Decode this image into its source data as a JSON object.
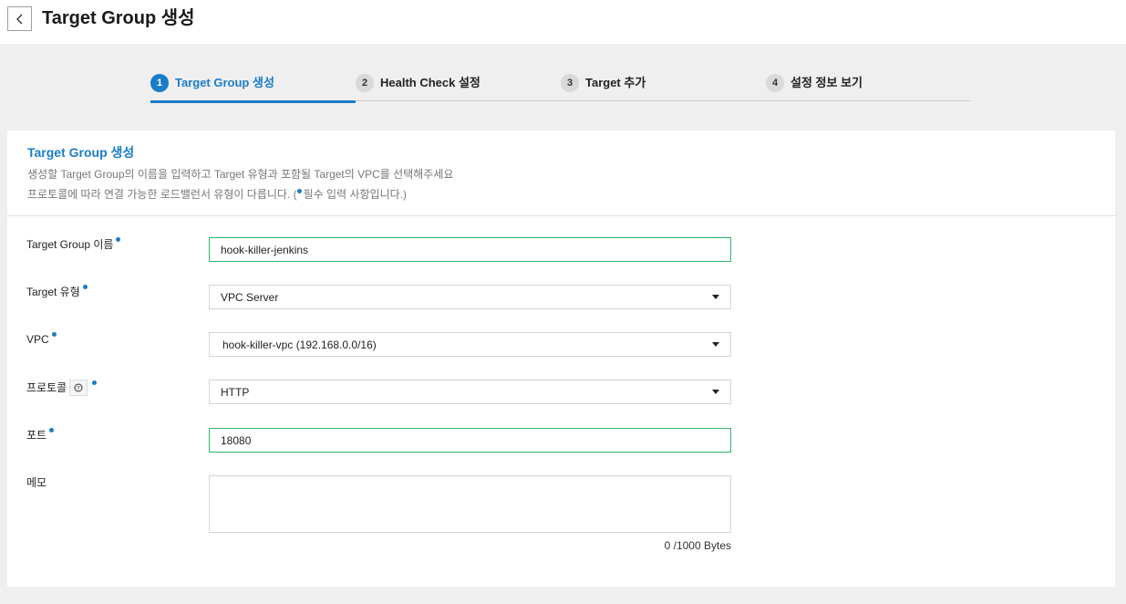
{
  "header": {
    "title": "Target Group 생성"
  },
  "steps": [
    {
      "num": "1",
      "label": "Target Group 생성"
    },
    {
      "num": "2",
      "label": "Health Check 설정"
    },
    {
      "num": "3",
      "label": "Target 추가"
    },
    {
      "num": "4",
      "label": "설정 정보 보기"
    }
  ],
  "card": {
    "title": "Target Group 생성",
    "desc1": "생성할 Target Group의 이름을 입력하고 Target 유형과 포함될 Target의 VPC를 선택해주세요",
    "desc2_before": "프로토콜에 따라 연결 가능한 로드밸런서 유형이 다릅니다. (",
    "desc2_after": "필수 입력 사항입니다.)"
  },
  "form": {
    "name": {
      "label": "Target Group 이름",
      "value": "hook-killer-jenkins"
    },
    "type": {
      "label": "Target 유형",
      "value": "VPC Server"
    },
    "vpc": {
      "label": "VPC",
      "value": "hook-killer-vpc (192.168.0.0/16)"
    },
    "protocol": {
      "label": "프로토콜",
      "value": "HTTP"
    },
    "port": {
      "label": "포트",
      "value": "18080"
    },
    "memo": {
      "label": "메모",
      "value": "",
      "counter": "0 /1000 Bytes"
    }
  },
  "icons": {
    "back": "chevron-left-icon",
    "help": "question-circle-icon",
    "select": "caret-down-icon"
  },
  "colors": {
    "accent": "#1a7dc8",
    "focus_border": "#31b56a"
  }
}
